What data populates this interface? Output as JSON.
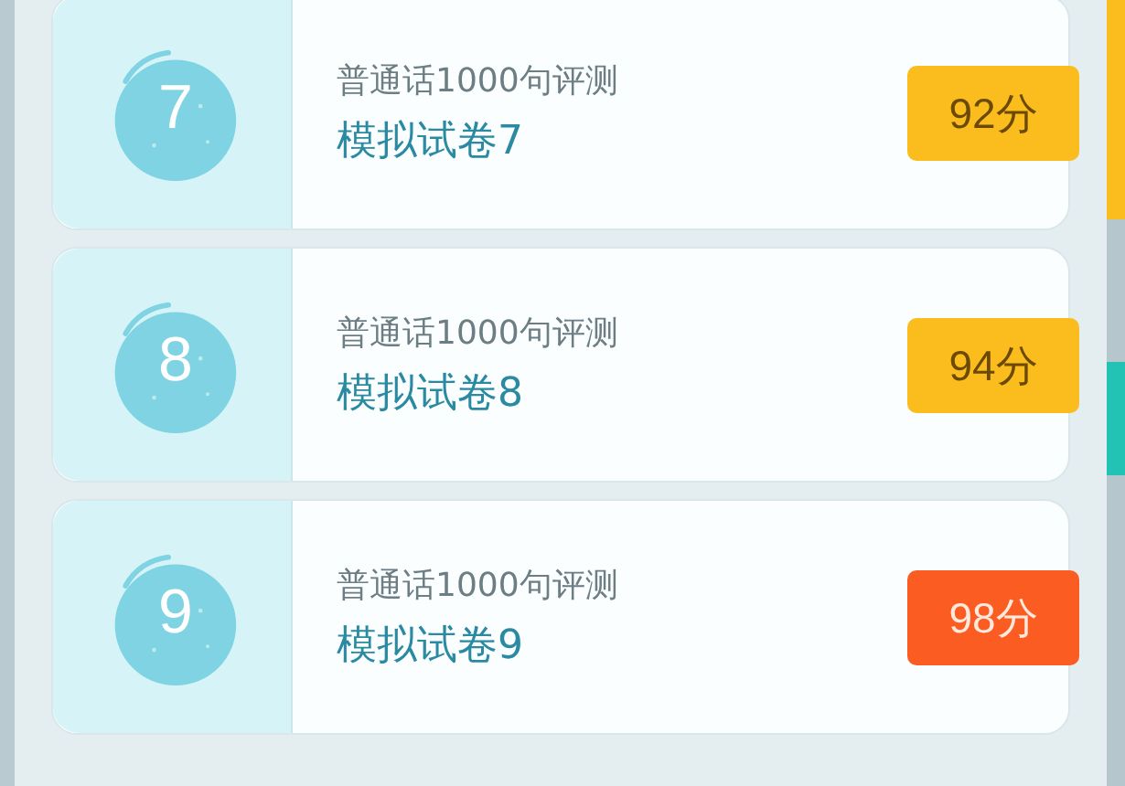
{
  "papers": [
    {
      "number": "7",
      "subtitle": "普通话1000句评测",
      "title": "模拟试卷7",
      "score": "92分",
      "color": "#fbbd1e"
    },
    {
      "number": "8",
      "subtitle": "普通话1000句评测",
      "title": "模拟试卷8",
      "score": "94分",
      "color": "#fbbd1e"
    },
    {
      "number": "9",
      "subtitle": "普通话1000句评测",
      "title": "模拟试卷9",
      "score": "98分",
      "color": "#fb5c22"
    }
  ]
}
